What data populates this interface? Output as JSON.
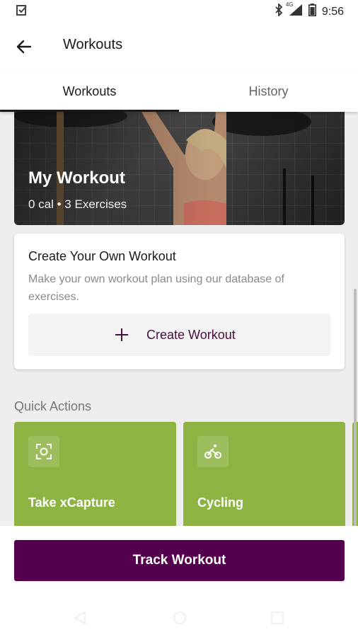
{
  "status_bar": {
    "time": "9:56",
    "network_label": "4G",
    "icons": [
      "checkbox-app-icon",
      "bluetooth-icon",
      "signal-icon",
      "battery-icon"
    ]
  },
  "app_bar": {
    "title": "Workouts",
    "back_icon": "arrow-left-icon"
  },
  "tabs": [
    {
      "label": "Workouts",
      "active": true
    },
    {
      "label": "History",
      "active": false
    }
  ],
  "hero": {
    "title": "My Workout",
    "subtitle": "0 cal • 3 Exercises"
  },
  "create_card": {
    "title": "Create Your Own Workout",
    "description": "Make your own workout plan using our database of exercises.",
    "button_label": "Create Workout",
    "button_icon": "plus-icon"
  },
  "quick_actions": {
    "title": "Quick Actions",
    "items": [
      {
        "label": "Take xCapture",
        "icon": "capture-icon"
      },
      {
        "label": "Cycling",
        "icon": "bicycle-icon"
      }
    ]
  },
  "bottom": {
    "track_button_label": "Track Workout"
  },
  "colors": {
    "primary": "#55004e",
    "quick_action_green": "#8db443",
    "create_label": "#4a0d3f"
  }
}
